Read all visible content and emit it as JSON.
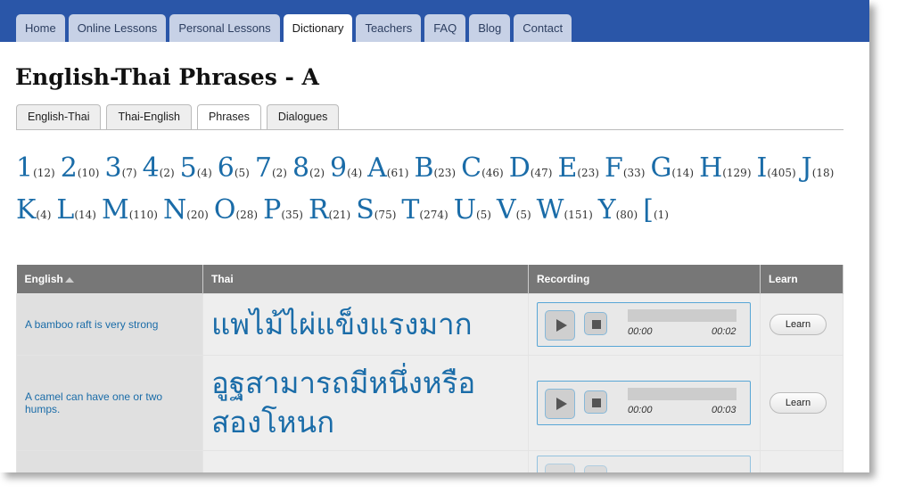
{
  "nav": {
    "tabs": [
      {
        "label": "Home"
      },
      {
        "label": "Online Lessons"
      },
      {
        "label": "Personal Lessons"
      },
      {
        "label": "Dictionary",
        "active": true
      },
      {
        "label": "Teachers"
      },
      {
        "label": "FAQ"
      },
      {
        "label": "Blog"
      },
      {
        "label": "Contact"
      }
    ]
  },
  "page": {
    "title": "English-Thai Phrases - A"
  },
  "subtabs": [
    {
      "label": "English-Thai"
    },
    {
      "label": "Thai-English"
    },
    {
      "label": "Phrases",
      "active": true
    },
    {
      "label": "Dialogues"
    }
  ],
  "letters": [
    {
      "ch": "1",
      "count": "(12)"
    },
    {
      "ch": "2",
      "count": "(10)"
    },
    {
      "ch": "3",
      "count": "(7)"
    },
    {
      "ch": "4",
      "count": "(2)"
    },
    {
      "ch": "5",
      "count": "(4)"
    },
    {
      "ch": "6",
      "count": "(5)"
    },
    {
      "ch": "7",
      "count": "(2)"
    },
    {
      "ch": "8",
      "count": "(2)"
    },
    {
      "ch": "9",
      "count": "(4)"
    },
    {
      "ch": "A",
      "count": "(61)"
    },
    {
      "ch": "B",
      "count": "(23)"
    },
    {
      "ch": "C",
      "count": "(46)"
    },
    {
      "ch": "D",
      "count": "(47)"
    },
    {
      "ch": "E",
      "count": "(23)"
    },
    {
      "ch": "F",
      "count": "(33)"
    },
    {
      "ch": "G",
      "count": "(14)"
    },
    {
      "ch": "H",
      "count": "(129)"
    },
    {
      "ch": "I",
      "count": "(405)"
    },
    {
      "ch": "J",
      "count": "(18)"
    },
    {
      "ch": "K",
      "count": "(4)"
    },
    {
      "ch": "L",
      "count": "(14)"
    },
    {
      "ch": "M",
      "count": "(110)"
    },
    {
      "ch": "N",
      "count": "(20)"
    },
    {
      "ch": "O",
      "count": "(28)"
    },
    {
      "ch": "P",
      "count": "(35)"
    },
    {
      "ch": "R",
      "count": "(21)"
    },
    {
      "ch": "S",
      "count": "(75)"
    },
    {
      "ch": "T",
      "count": "(274)"
    },
    {
      "ch": "U",
      "count": "(5)"
    },
    {
      "ch": "V",
      "count": "(5)"
    },
    {
      "ch": "W",
      "count": "(151)"
    },
    {
      "ch": "Y",
      "count": "(80)"
    },
    {
      "ch": "[",
      "count": "(1)"
    }
  ],
  "table": {
    "headers": {
      "english": "English",
      "thai": "Thai",
      "recording": "Recording",
      "learn": "Learn"
    },
    "rows": [
      {
        "english": "A bamboo raft is very strong",
        "thai": "แพไม้ไผ่แข็งแรงมาก",
        "time_current": "00:00",
        "time_total": "00:02",
        "learn": "Learn"
      },
      {
        "english": "A camel can have one or two humps.",
        "thai": "อูฐสามารถมีหนึ่งหรือสองโหนก",
        "time_current": "00:00",
        "time_total": "00:03",
        "learn": "Learn"
      }
    ]
  }
}
